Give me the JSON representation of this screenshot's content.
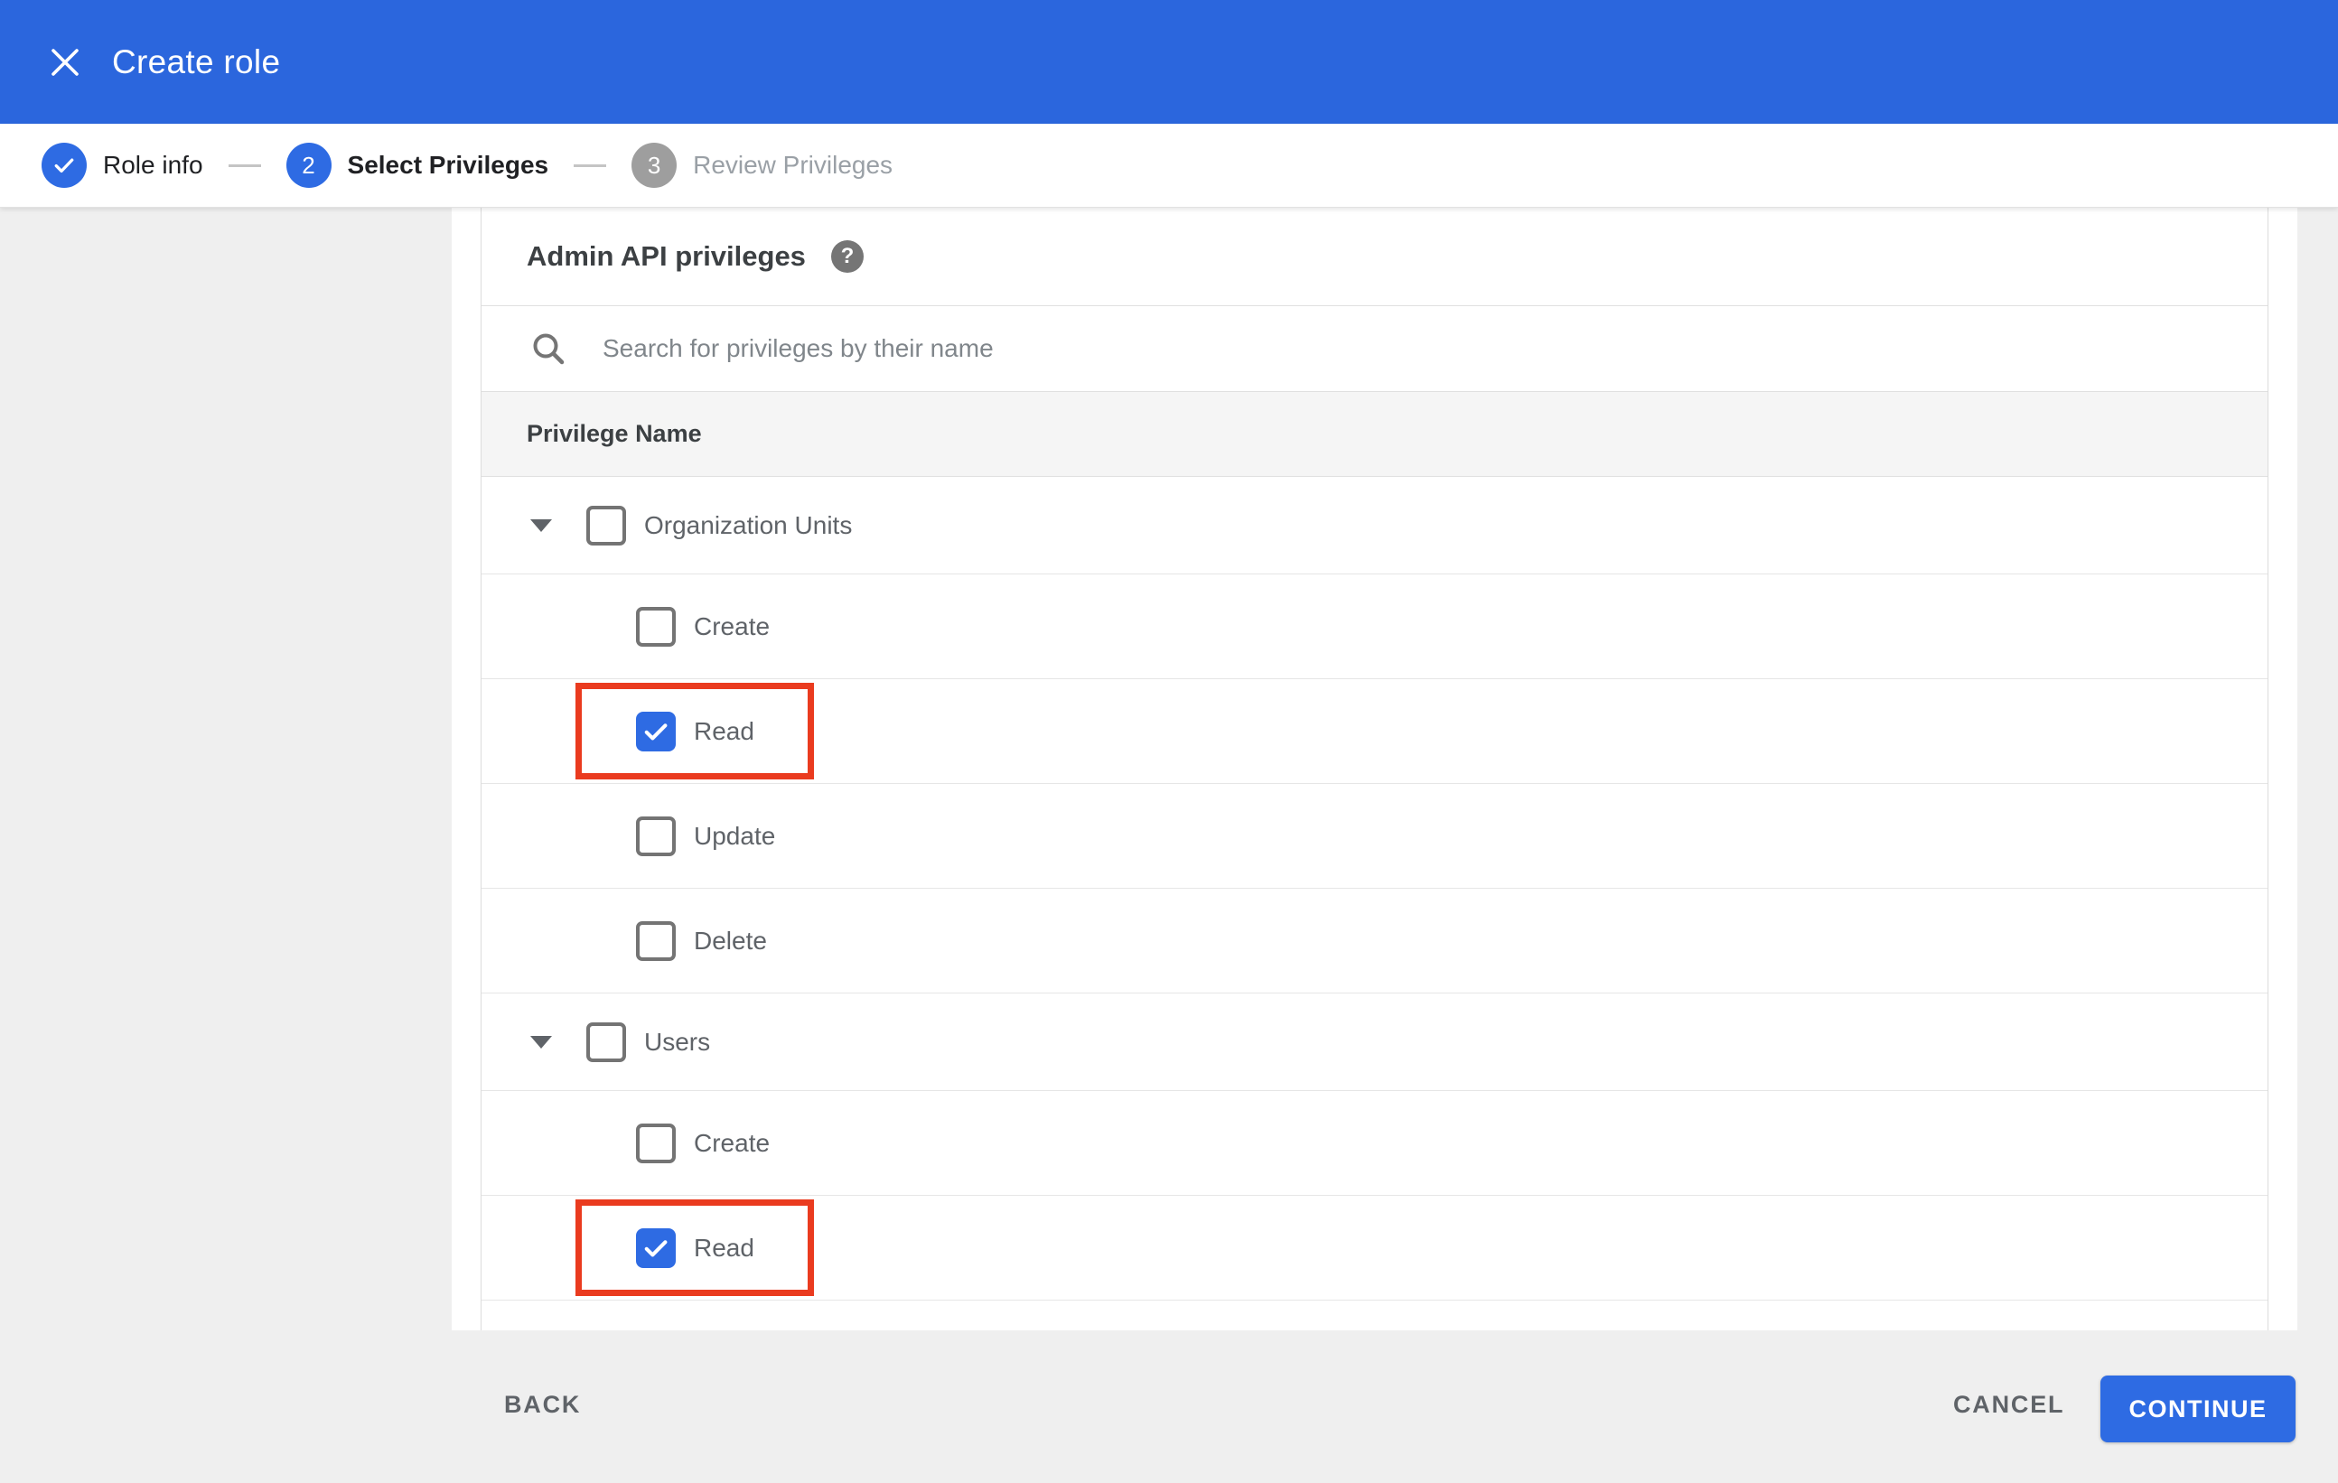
{
  "header": {
    "title": "Create role",
    "close_icon": "close-icon"
  },
  "stepper": {
    "steps": [
      {
        "number": "1",
        "label": "Role info",
        "state": "completed",
        "icon": "check-icon"
      },
      {
        "number": "2",
        "label": "Select Privileges",
        "state": "active"
      },
      {
        "number": "3",
        "label": "Review Privileges",
        "state": "upcoming"
      }
    ]
  },
  "panel": {
    "title": "Admin API privileges",
    "help_icon": "help-icon",
    "help_glyph": "?",
    "search_icon": "search-icon",
    "search_placeholder": "Search for privileges by their name",
    "search_value": "",
    "table_header": "Privilege Name",
    "groups": [
      {
        "label": "Organization Units",
        "checked": false,
        "expanded": true,
        "children": [
          {
            "label": "Create",
            "checked": false,
            "highlighted": false
          },
          {
            "label": "Read",
            "checked": true,
            "highlighted": true
          },
          {
            "label": "Update",
            "checked": false,
            "highlighted": false
          },
          {
            "label": "Delete",
            "checked": false,
            "highlighted": false
          }
        ]
      },
      {
        "label": "Users",
        "checked": false,
        "expanded": true,
        "children": [
          {
            "label": "Create",
            "checked": false,
            "highlighted": false
          },
          {
            "label": "Read",
            "checked": true,
            "highlighted": true
          }
        ]
      }
    ]
  },
  "footer": {
    "back_label": "BACK",
    "cancel_label": "CANCEL",
    "continue_label": "CONTINUE"
  },
  "colors": {
    "appbar_blue": "#2b66dd",
    "accent_blue": "#2e6be3",
    "highlight_red": "#ea3b1f",
    "page_bg": "#efefef"
  }
}
